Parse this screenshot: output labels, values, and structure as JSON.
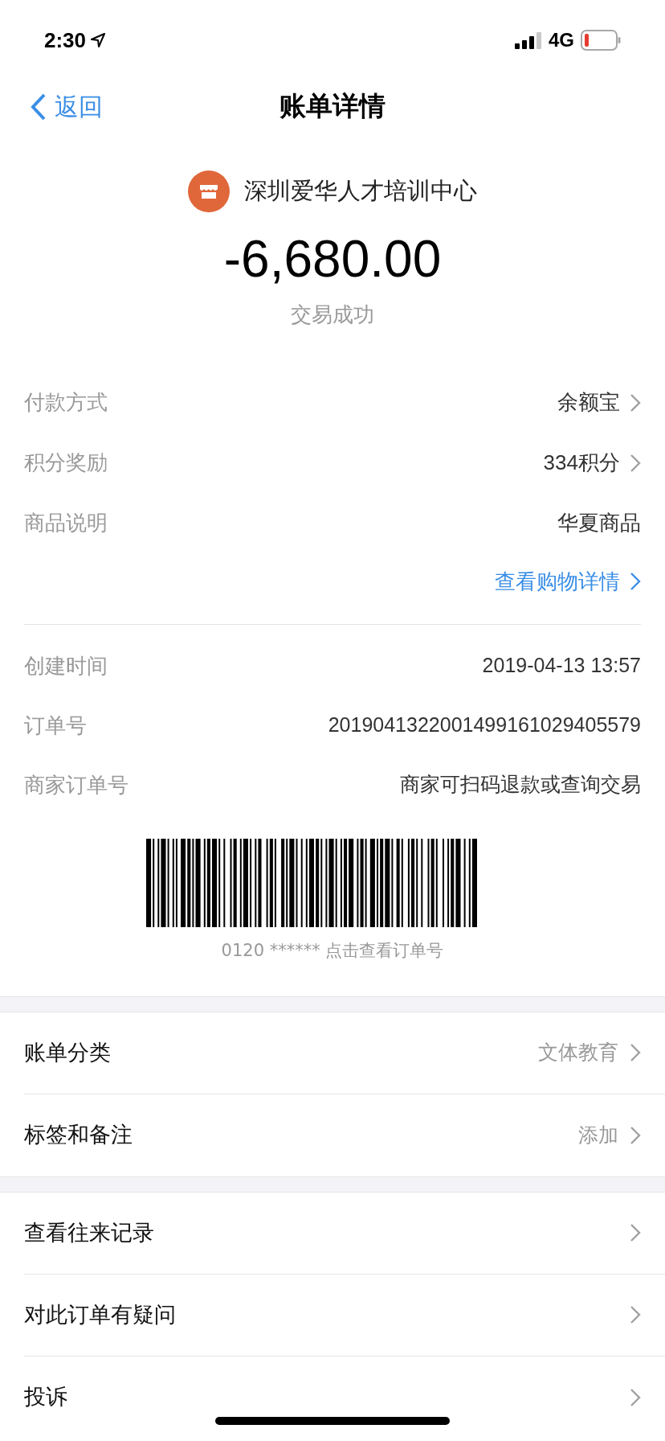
{
  "status_bar": {
    "time": "2:30",
    "network": "4G"
  },
  "nav": {
    "back": "返回",
    "title": "账单详情"
  },
  "merchant": {
    "name": "深圳爱华人才培训中心",
    "amount": "-6,680.00",
    "status": "交易成功"
  },
  "details": [
    {
      "label": "付款方式",
      "value": "余额宝",
      "chevron": true
    },
    {
      "label": "积分奖励",
      "value": "334积分",
      "chevron": true
    },
    {
      "label": "商品说明",
      "value": "华夏商品",
      "chevron": false
    }
  ],
  "shopping_link": "查看购物详情",
  "order_info": [
    {
      "label": "创建时间",
      "value": "2019-04-13 13:57"
    },
    {
      "label": "订单号",
      "value": "2019041322001499161029405579"
    },
    {
      "label": "商家订单号",
      "value": "商家可扫码退款或查询交易"
    }
  ],
  "barcode_caption": "0120 ****** 点击查看订单号",
  "settings": [
    {
      "label": "账单分类",
      "value": "文体教育"
    },
    {
      "label": "标签和备注",
      "value": "添加"
    }
  ],
  "actions": [
    {
      "label": "查看往来记录"
    },
    {
      "label": "对此订单有疑问"
    },
    {
      "label": "投诉"
    }
  ]
}
